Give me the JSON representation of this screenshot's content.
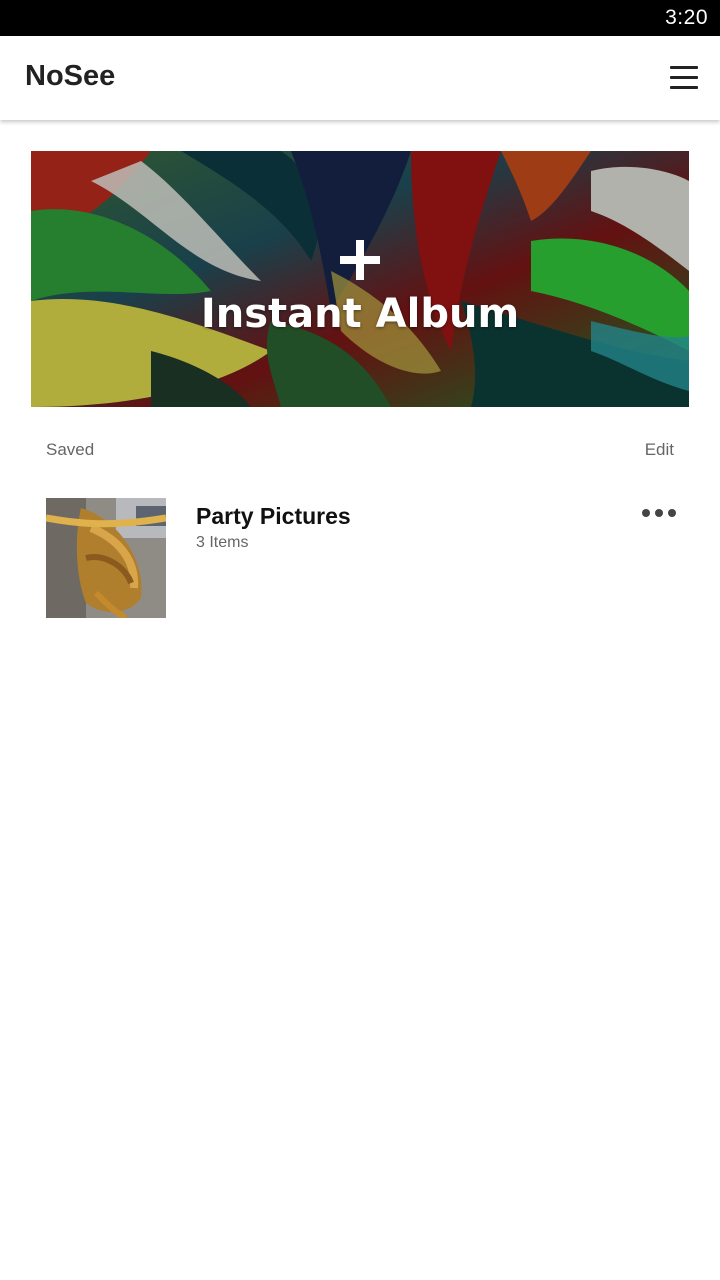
{
  "status_bar": {
    "time": "3:20"
  },
  "app_bar": {
    "title": "NoSee",
    "menu_icon": "hamburger-menu-icon"
  },
  "hero": {
    "plus_icon": "plus-icon",
    "label": "Instant Album"
  },
  "saved_section": {
    "label": "Saved",
    "edit_label": "Edit"
  },
  "albums": [
    {
      "title": "Party Pictures",
      "count": "3 Items",
      "more_icon": "more-horizontal-icon"
    }
  ]
}
